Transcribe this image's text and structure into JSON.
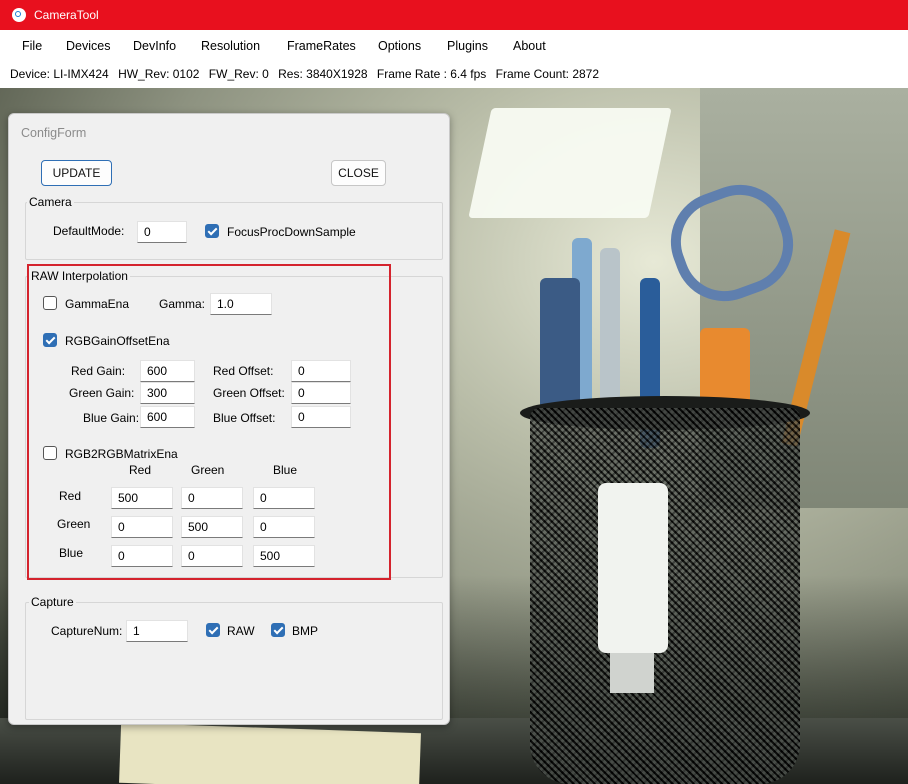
{
  "window": {
    "title": "CameraTool"
  },
  "menu": [
    "File",
    "Devices",
    "DevInfo",
    "Resolution",
    "FrameRates",
    "Options",
    "Plugins",
    "About"
  ],
  "info": {
    "device": "Device:  LI-IMX424",
    "hw": "HW_Rev:  0102",
    "fw": "FW_Rev:  0",
    "res": "Res:  3840X1928",
    "fps": "Frame Rate :  6.4 fps",
    "count": "Frame Count: 2872"
  },
  "config": {
    "caption": "ConfigForm",
    "update": "UPDATE",
    "close": "CLOSE",
    "camera": {
      "title": "Camera",
      "default_mode_label": "DefaultMode:",
      "default_mode_value": "0",
      "focus_label": "FocusProcDownSample",
      "focus_checked": true
    },
    "raw": {
      "title": "RAW Interpolation",
      "gamma_ena_label": "GammaEna",
      "gamma_ena_checked": false,
      "gamma_label": "Gamma:",
      "gamma_value": "1.0",
      "gain_ena_label": "RGBGainOffsetEna",
      "gain_ena_checked": true,
      "red_gain_label": "Red Gain:",
      "red_gain": "600",
      "green_gain_label": "Green Gain:",
      "green_gain": "300",
      "blue_gain_label": "Blue Gain:",
      "blue_gain": "600",
      "red_offset_label": "Red Offset:",
      "red_offset": "0",
      "green_offset_label": "Green Offset:",
      "green_offset": "0",
      "blue_offset_label": "Blue Offset:",
      "blue_offset": "0",
      "matrix_ena_label": "RGB2RGBMatrixEna",
      "matrix_ena_checked": false,
      "matrix_cols": [
        "Red",
        "Green",
        "Blue"
      ],
      "matrix_rows": [
        "Red",
        "Green",
        "Blue"
      ],
      "matrix": [
        [
          "500",
          "0",
          "0"
        ],
        [
          "0",
          "500",
          "0"
        ],
        [
          "0",
          "0",
          "500"
        ]
      ]
    },
    "capture": {
      "title": "Capture",
      "num_label": "CaptureNum:",
      "num_value": "1",
      "raw_label": "RAW",
      "raw_checked": true,
      "bmp_label": "BMP",
      "bmp_checked": true
    }
  },
  "colors": {
    "titlebar": "#e8101e",
    "accent": "#2f6fb5",
    "highlight": "#d4232d"
  }
}
